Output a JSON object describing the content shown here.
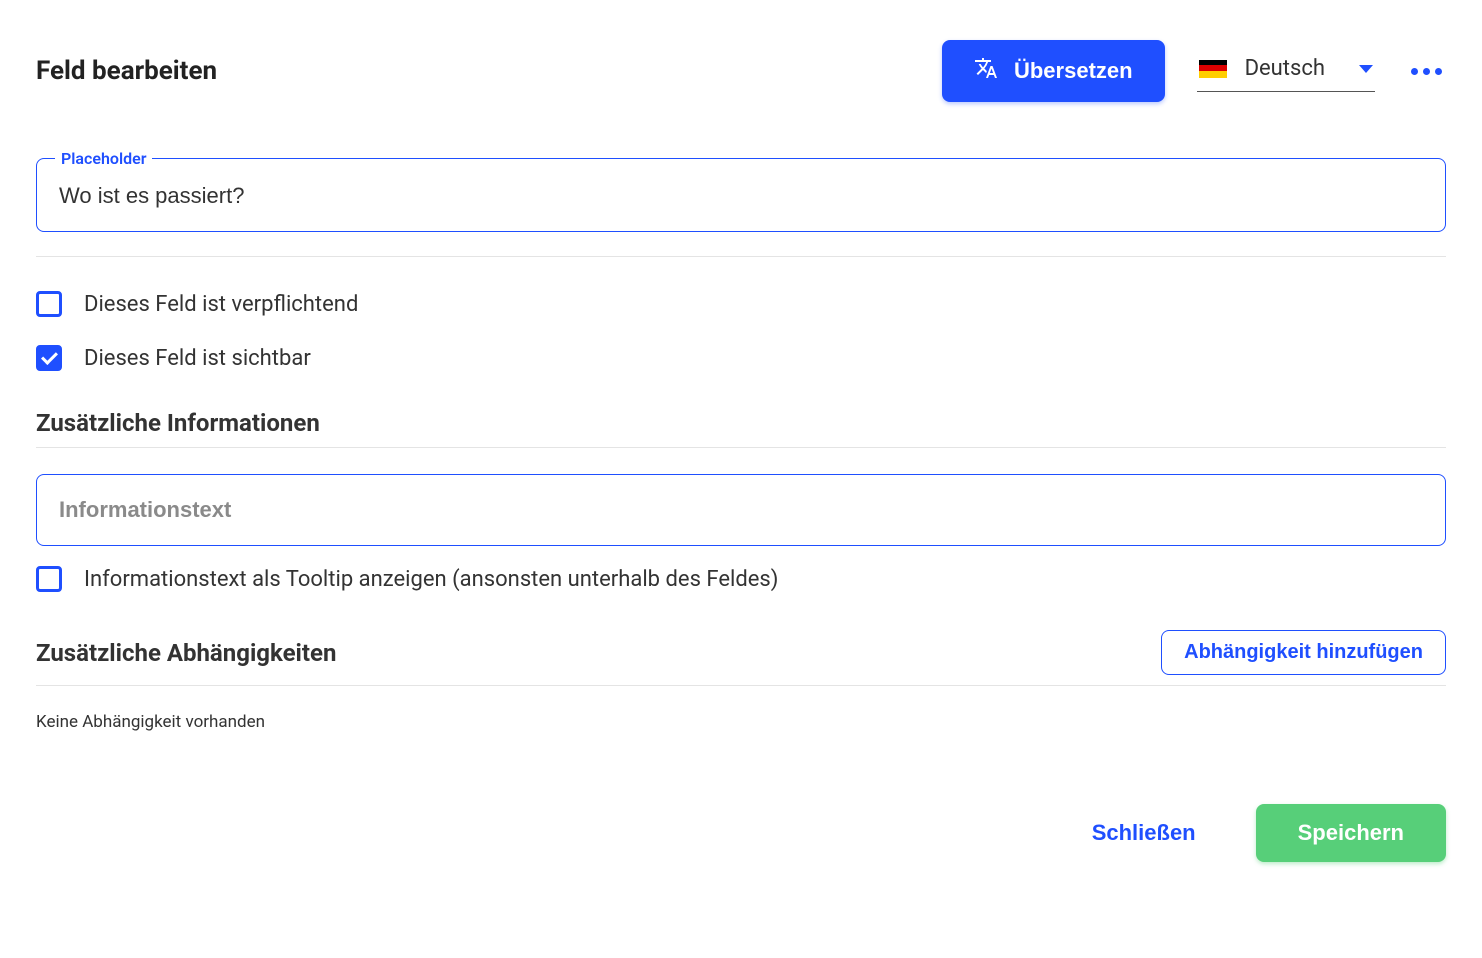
{
  "header": {
    "title": "Feld bearbeiten",
    "translate_label": "Übersetzen",
    "language_label": "Deutsch"
  },
  "placeholder_field": {
    "legend": "Placeholder",
    "value": "Wo ist es passiert?"
  },
  "checks": {
    "required_label": "Dieses Feld ist verpflichtend",
    "visible_label": "Dieses Feld ist sichtbar"
  },
  "additional_info": {
    "title": "Zusätzliche Informationen",
    "input_placeholder": "Informationstext",
    "tooltip_label": "Informationstext als Tooltip anzeigen (ansonsten unterhalb des Feldes)"
  },
  "dependencies": {
    "title": "Zusätzliche Abhängigkeiten",
    "add_button": "Abhängigkeit hinzufügen",
    "empty": "Keine Abhängigkeit vorhanden"
  },
  "footer": {
    "close": "Schließen",
    "save": "Speichern"
  }
}
